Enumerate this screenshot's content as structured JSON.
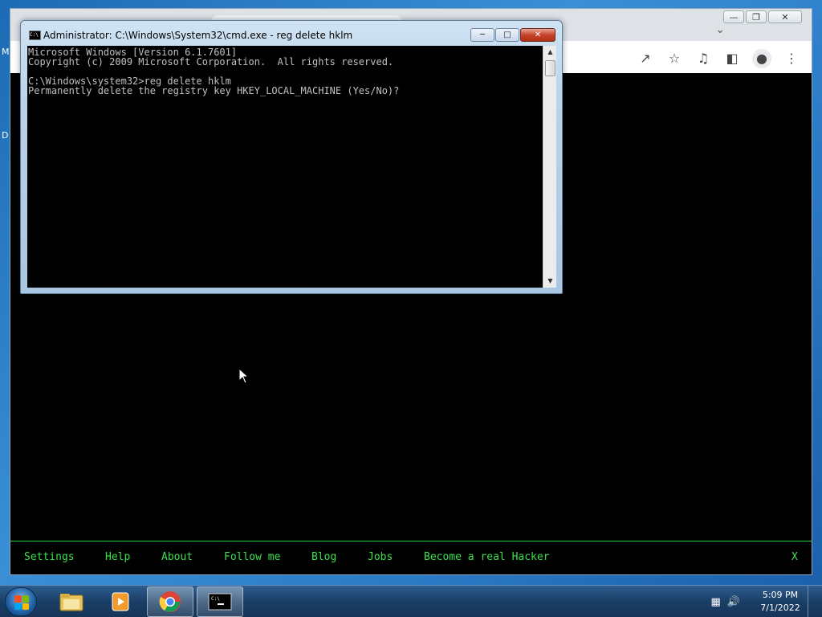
{
  "desktop": {
    "edge_letters": [
      "M",
      "D"
    ]
  },
  "browser": {
    "toolbar_icons": [
      "share-icon",
      "star-icon",
      "media-icon",
      "side-panel-icon",
      "profile-icon",
      "menu-icon"
    ],
    "hacker_menu": {
      "items": [
        "Settings",
        "Help",
        "About",
        "Follow me",
        "Blog",
        "Jobs",
        "Become a real Hacker"
      ],
      "close": "X",
      "color": "#3ce04e"
    }
  },
  "cmd": {
    "title": "Administrator: C:\\Windows\\System32\\cmd.exe - reg  delete hklm",
    "lines": [
      "Microsoft Windows [Version 6.1.7601]",
      "Copyright (c) 2009 Microsoft Corporation.  All rights reserved.",
      "",
      "C:\\Windows\\system32>reg delete hklm",
      "Permanently delete the registry key HKEY_LOCAL_MACHINE (Yes/No)?"
    ]
  },
  "taskbar": {
    "items": [
      "explorer-icon",
      "media-player-icon",
      "chrome-icon",
      "cmd-icon"
    ],
    "time": "5:09 PM",
    "date": "7/1/2022"
  }
}
